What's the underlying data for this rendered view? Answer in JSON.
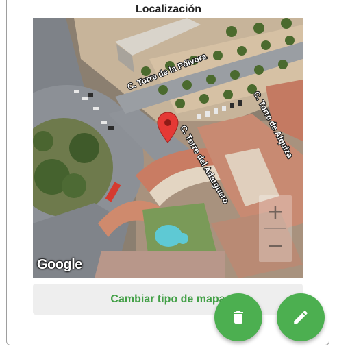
{
  "section": {
    "title": "Localización"
  },
  "map": {
    "streets": [
      "C. Torre de la Pólvora",
      "C. Torre de Alquiza",
      "C. Torre del Adarguero"
    ],
    "provider_logo": "Google",
    "zoom_in_label": "+",
    "zoom_out_label": "−",
    "marker_icon": "map-pin-icon",
    "marker_color": "#e53935"
  },
  "actions": {
    "map_type_label": "Cambiar tipo de mapa",
    "delete_icon": "trash-icon",
    "edit_icon": "pencil-icon"
  },
  "colors": {
    "accent": "#4caf50",
    "button_text": "#43a047"
  }
}
